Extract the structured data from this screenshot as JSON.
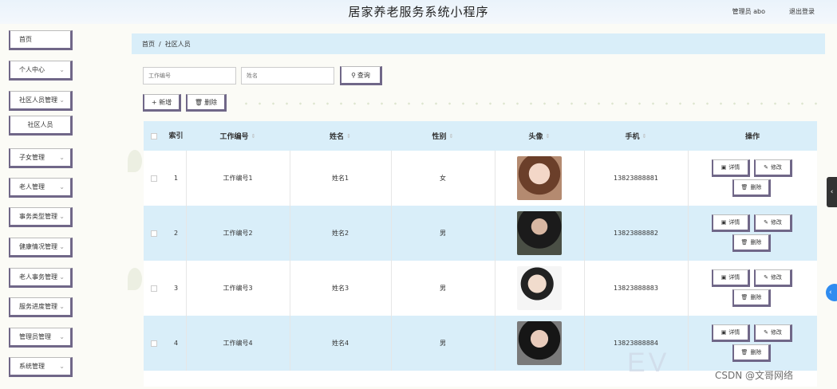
{
  "header": {
    "title": "居家养老服务系统小程序",
    "user_label": "管理员 abo",
    "logout_label": "退出登录"
  },
  "sidebar": {
    "items": [
      {
        "label": "首页",
        "has_chevron": false
      },
      {
        "label": "个人中心",
        "has_chevron": true
      },
      {
        "label": "社区人员管理",
        "has_chevron": true
      },
      {
        "label": "社区人员",
        "has_chevron": false,
        "sub": true
      },
      {
        "label": "子女管理",
        "has_chevron": true
      },
      {
        "label": "老人管理",
        "has_chevron": true
      },
      {
        "label": "事务类型管理",
        "has_chevron": true
      },
      {
        "label": "健康情况管理",
        "has_chevron": true
      },
      {
        "label": "老人事务管理",
        "has_chevron": true
      },
      {
        "label": "服务进度管理",
        "has_chevron": true
      },
      {
        "label": "管理员管理",
        "has_chevron": true
      },
      {
        "label": "系统管理",
        "has_chevron": true
      }
    ]
  },
  "breadcrumb": {
    "home": "首页",
    "separator": "/",
    "current": "社区人员"
  },
  "search": {
    "work_no_placeholder": "工作编号",
    "name_placeholder": "姓名",
    "query_label": "查询"
  },
  "toolbar": {
    "add_label": "+ 新增",
    "delete_label": "删除"
  },
  "table": {
    "headers": {
      "index": "索引",
      "work_no": "工作编号",
      "name": "姓名",
      "gender": "性别",
      "avatar": "头像",
      "phone": "手机",
      "ops": "操作"
    },
    "sort_glyph": "⇕",
    "rows": [
      {
        "index": "1",
        "work_no": "工作编号1",
        "name": "姓名1",
        "gender": "女",
        "phone": "13823888881"
      },
      {
        "index": "2",
        "work_no": "工作编号2",
        "name": "姓名2",
        "gender": "男",
        "phone": "13823888882"
      },
      {
        "index": "3",
        "work_no": "工作编号3",
        "name": "姓名3",
        "gender": "男",
        "phone": "13823888883"
      },
      {
        "index": "4",
        "work_no": "工作编号4",
        "name": "姓名4",
        "gender": "男",
        "phone": "13823888884"
      }
    ],
    "actions": {
      "detail": "详情",
      "edit": "修改",
      "delete": "删除"
    }
  },
  "watermark": "CSDN @文哥网络",
  "colors": {
    "accent": "#706788",
    "header_bg": "#d9eef9",
    "alt_row": "#d9eef9"
  }
}
